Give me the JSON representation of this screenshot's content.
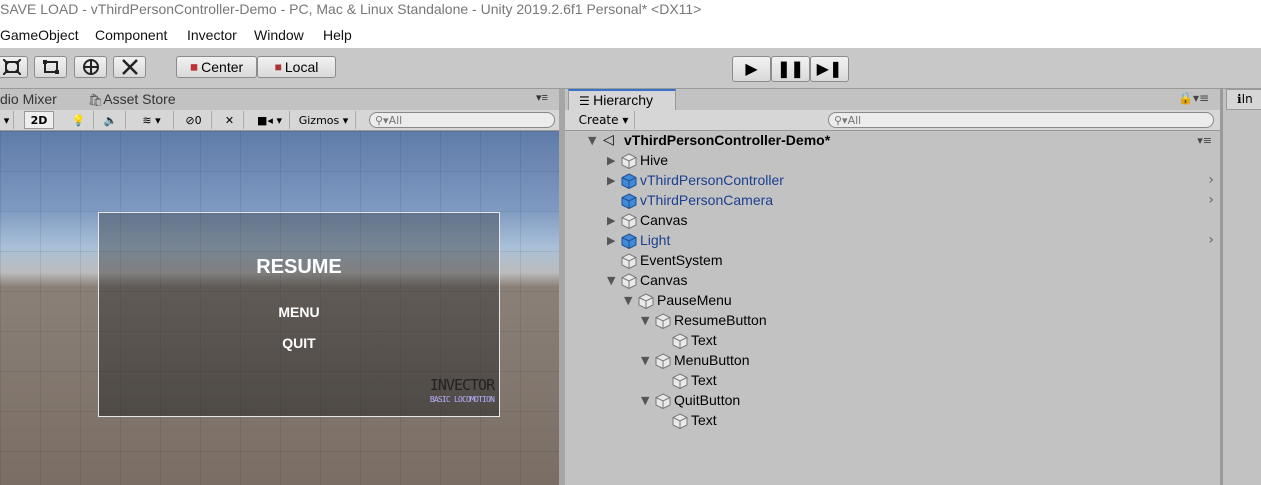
{
  "window": {
    "title": "SAVE LOAD - vThirdPersonController-Demo - PC, Mac & Linux Standalone - Unity 2019.2.6f1 Personal* <DX11>"
  },
  "menu": {
    "items": [
      "GameObject",
      "Component",
      "Invector",
      "Window",
      "Help"
    ]
  },
  "toolbar": {
    "pivot_mode_label": "Center",
    "pivot_rotation_label": "Local"
  },
  "scene": {
    "tabs": [
      "dio Mixer",
      "Asset Store"
    ],
    "toolbar": {
      "mode_2d": "2D",
      "hidden_count": "0",
      "gizmos_label": "Gizmos",
      "search_placeholder": "All"
    },
    "game_ui": {
      "resume": "RESUME",
      "menu": "MENU",
      "quit": "QUIT",
      "logo_main": "INVECTOR",
      "logo_sub": "BASIC LOCOMOTION"
    }
  },
  "hierarchy": {
    "tab_label": "Hierarchy",
    "create_label": "Create",
    "search_placeholder": "All",
    "scene_name": "vThirdPersonController-Demo*",
    "items": [
      {
        "label": "Hive",
        "prefab": false,
        "expand": "collapsed",
        "chevron": false
      },
      {
        "label": "vThirdPersonController",
        "prefab": true,
        "expand": "collapsed",
        "chevron": true
      },
      {
        "label": "vThirdPersonCamera",
        "prefab": true,
        "expand": "none",
        "chevron": true
      },
      {
        "label": "Canvas",
        "prefab": false,
        "expand": "collapsed",
        "chevron": false
      },
      {
        "label": "Light",
        "prefab": true,
        "expand": "collapsed",
        "chevron": true
      },
      {
        "label": "EventSystem",
        "prefab": false,
        "expand": "none",
        "chevron": false
      },
      {
        "label": "Canvas",
        "prefab": false,
        "expand": "expanded",
        "chevron": false
      },
      {
        "label": "PauseMenu",
        "prefab": false,
        "expand": "expanded",
        "chevron": false
      },
      {
        "label": "ResumeButton",
        "prefab": false,
        "expand": "expanded",
        "chevron": false
      },
      {
        "label": "Text",
        "prefab": false,
        "expand": "none",
        "chevron": false
      },
      {
        "label": "MenuButton",
        "prefab": false,
        "expand": "expanded",
        "chevron": false
      },
      {
        "label": "Text",
        "prefab": false,
        "expand": "none",
        "chevron": false
      },
      {
        "label": "QuitButton",
        "prefab": false,
        "expand": "expanded",
        "chevron": false
      },
      {
        "label": "Text",
        "prefab": false,
        "expand": "none",
        "chevron": false
      }
    ]
  },
  "inspector": {
    "tab_label": "In"
  },
  "colors": {
    "prefab_text": "#1b3f8f",
    "tab_accent": "#3a72c8"
  }
}
